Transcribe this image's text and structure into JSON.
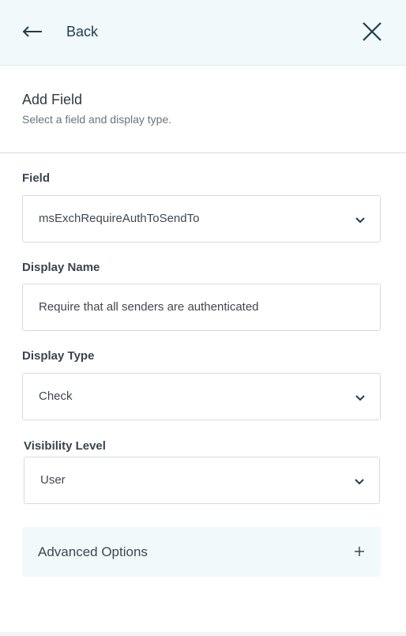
{
  "topbar": {
    "back_label": "Back"
  },
  "header": {
    "title": "Add Field",
    "subtitle": "Select a field and display type."
  },
  "form": {
    "field": {
      "label": "Field",
      "value": "msExchRequireAuthToSendTo"
    },
    "display_name": {
      "label": "Display Name",
      "value": "Require that all senders are authenticated"
    },
    "display_type": {
      "label": "Display Type",
      "value": "Check"
    },
    "visibility": {
      "label": "Visibility Level",
      "value": "User"
    }
  },
  "advanced": {
    "label": "Advanced Options"
  },
  "icons": {
    "back": "arrow-left-icon",
    "close": "close-icon",
    "chevron": "chevron-down-icon",
    "plus": "plus-icon"
  },
  "colors": {
    "topbar_bg": "#f1f9fb",
    "accent": "#1e3d4f"
  }
}
